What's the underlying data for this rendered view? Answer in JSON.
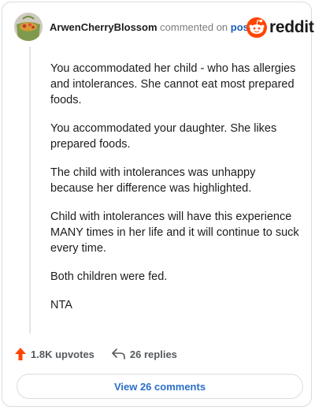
{
  "comment": {
    "username": "ArwenCherryBlossom",
    "action_text": "commented on",
    "link_text": "post",
    "paragraphs": [
      "You accommodated her child - who has allergies and intolerances. She cannot eat most prepared foods.",
      "You accommodated your daughter. She likes prepared foods.",
      "The child with intolerances was unhappy because her difference was highlighted.",
      "Child with intolerances will have this experience MANY times in her life and it will continue to suck every time.",
      "Both children were fed.",
      "NTA"
    ]
  },
  "brand": {
    "wordmark": "reddit",
    "accent": "#ff4500",
    "icon": "reddit-snoo-icon"
  },
  "stats": {
    "upvotes": "1.8K upvotes",
    "replies": "26 replies",
    "upvote_icon": "upvote-arrow-icon",
    "reply_icon": "reply-arrow-icon",
    "upvote_color": "#ff4500"
  },
  "actions": {
    "view_comments": "View 26 comments"
  },
  "colors": {
    "link": "#1b5fb3",
    "button_text": "#2b6ec8",
    "border": "#d9dde0"
  }
}
